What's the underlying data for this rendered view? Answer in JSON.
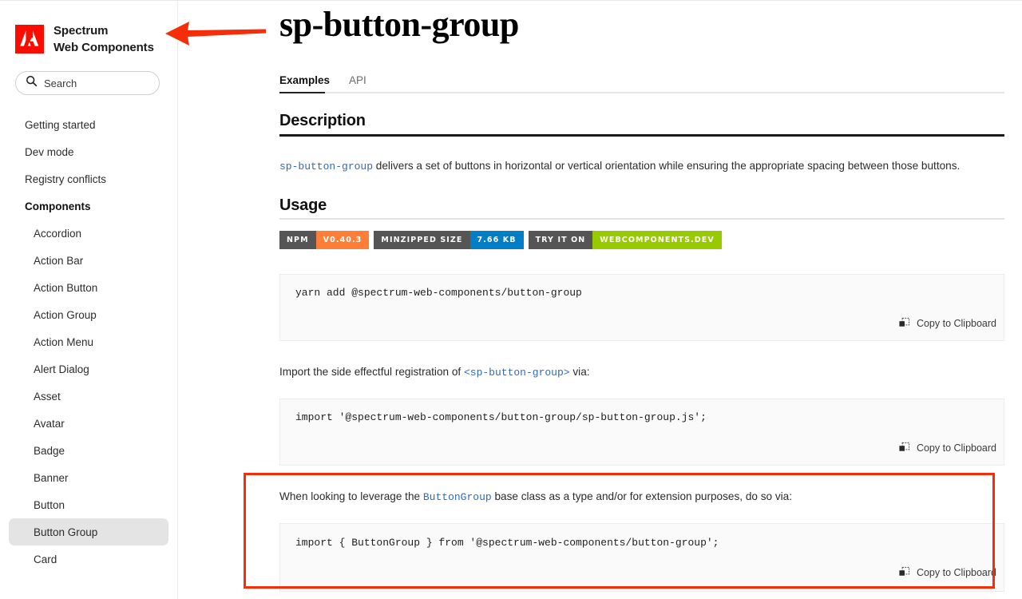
{
  "brand": {
    "line1": "Spectrum",
    "line2": "Web Components",
    "logo_icon": "adobe-logo-icon"
  },
  "search": {
    "placeholder": "Search",
    "icon": "search-icon"
  },
  "sidebar": {
    "items": [
      {
        "label": "Getting started",
        "level": 0,
        "section": false,
        "active": false
      },
      {
        "label": "Dev mode",
        "level": 0,
        "section": false,
        "active": false
      },
      {
        "label": "Registry conflicts",
        "level": 0,
        "section": false,
        "active": false
      },
      {
        "label": "Components",
        "level": 0,
        "section": true,
        "active": false
      },
      {
        "label": "Accordion",
        "level": 1,
        "section": false,
        "active": false
      },
      {
        "label": "Action Bar",
        "level": 1,
        "section": false,
        "active": false
      },
      {
        "label": "Action Button",
        "level": 1,
        "section": false,
        "active": false
      },
      {
        "label": "Action Group",
        "level": 1,
        "section": false,
        "active": false
      },
      {
        "label": "Action Menu",
        "level": 1,
        "section": false,
        "active": false
      },
      {
        "label": "Alert Dialog",
        "level": 1,
        "section": false,
        "active": false
      },
      {
        "label": "Asset",
        "level": 1,
        "section": false,
        "active": false
      },
      {
        "label": "Avatar",
        "level": 1,
        "section": false,
        "active": false
      },
      {
        "label": "Badge",
        "level": 1,
        "section": false,
        "active": false
      },
      {
        "label": "Banner",
        "level": 1,
        "section": false,
        "active": false
      },
      {
        "label": "Button",
        "level": 1,
        "section": false,
        "active": false
      },
      {
        "label": "Button Group",
        "level": 1,
        "section": false,
        "active": true
      },
      {
        "label": "Card",
        "level": 1,
        "section": false,
        "active": false
      }
    ]
  },
  "annotation": {
    "arrow_icon": "red-left-arrow-icon",
    "arrow_color": "#f52d09",
    "highlight_color": "#f52d09"
  },
  "main": {
    "title": "sp-button-group",
    "tabs": [
      {
        "label": "Examples",
        "active": true
      },
      {
        "label": "API",
        "active": false
      }
    ],
    "description": {
      "heading": "Description",
      "code_term": "sp-button-group",
      "text": " delivers a set of buttons in horizontal or vertical orientation while ensuring the appropriate spacing between those buttons."
    },
    "usage": {
      "heading": "Usage"
    },
    "badges": [
      {
        "left_label": "NPM",
        "right_label": "V0.40.3",
        "right_color": "#fe7d37"
      },
      {
        "left_label": "MINZIPPED SIZE",
        "right_label": "7.66 KB",
        "right_color": "#007ec6"
      },
      {
        "left_label": "TRY IT ON",
        "right_label": "WEBCOMPONENTS.DEV",
        "right_color": "#97ca00"
      }
    ],
    "blocks": [
      {
        "code": "yarn add @spectrum-web-components/button-group",
        "copy_label": "Copy to Clipboard",
        "copy_icon": "copy-to-clipboard-icon"
      },
      {
        "code": "import '@spectrum-web-components/button-group/sp-button-group.js';",
        "copy_label": "Copy to Clipboard",
        "copy_icon": "copy-to-clipboard-icon"
      },
      {
        "code": "import { ButtonGroup } from '@spectrum-web-components/button-group';",
        "copy_label": "Copy to Clipboard",
        "copy_icon": "copy-to-clipboard-icon"
      }
    ],
    "intro_import": {
      "pre": "Import the side effectful registration of ",
      "code_term": "<sp-button-group>",
      "post": " via:"
    },
    "intro_base_class": {
      "pre": "When looking to leverage the ",
      "code_term": "ButtonGroup",
      "post": " base class as a type and/or for extension purposes, do so via:"
    }
  }
}
